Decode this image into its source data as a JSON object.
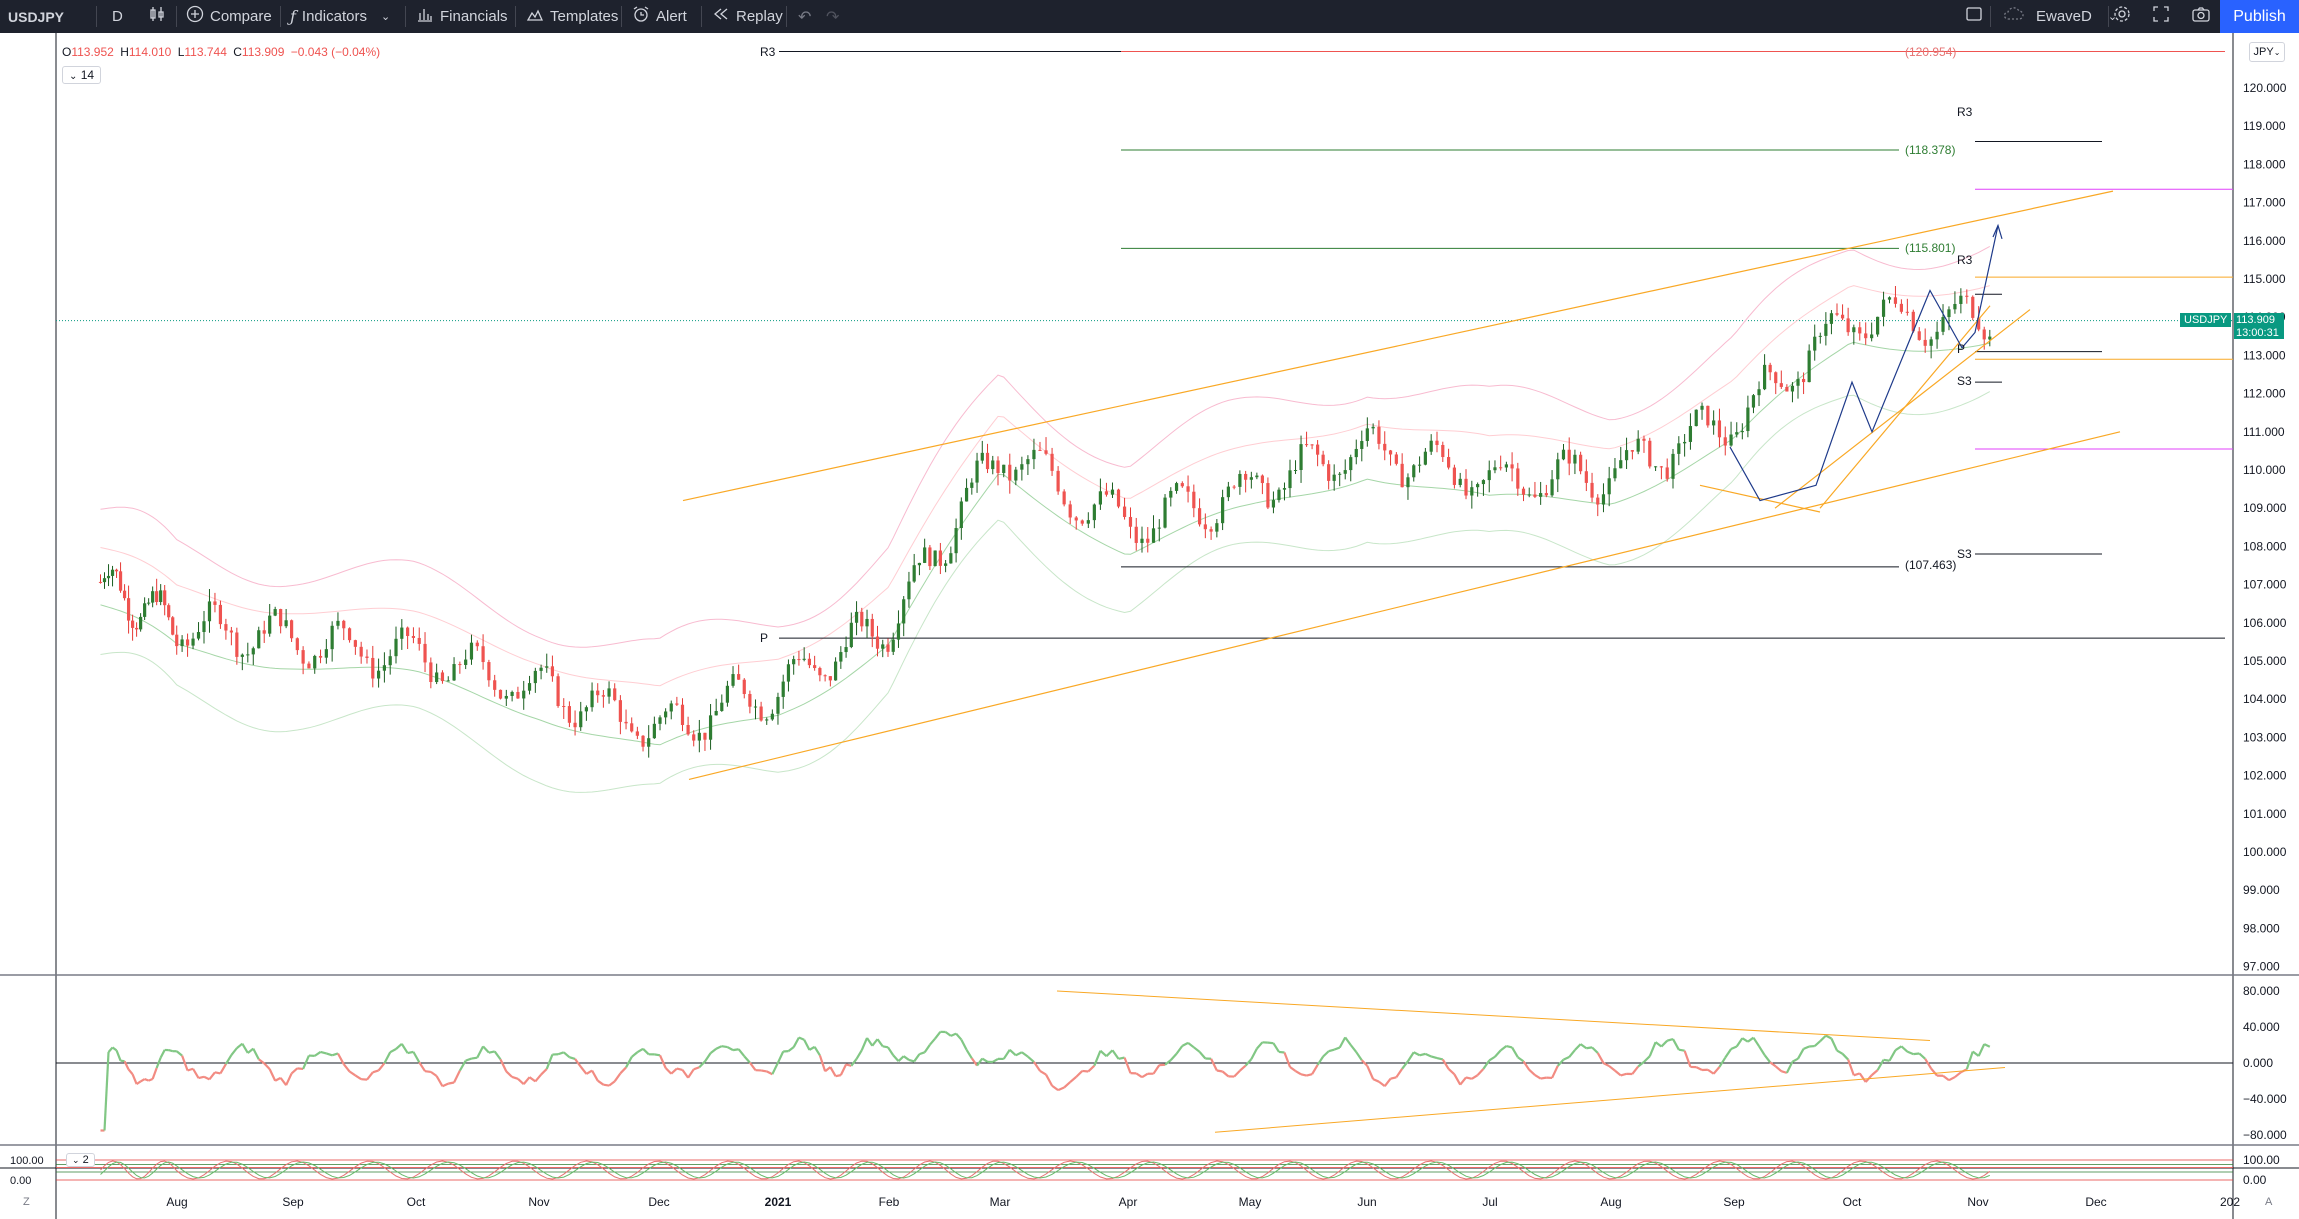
{
  "toolbar": {
    "symbol": "USDJPY",
    "interval": "D",
    "compare_label": "Compare",
    "indicators_label": "Indicators",
    "financials_label": "Financials",
    "templates_label": "Templates",
    "alert_label": "Alert",
    "replay_label": "Replay",
    "layout_name": "EwaveD",
    "publish_label": "Publish"
  },
  "legend": {
    "open_label": "O",
    "open": "113.952",
    "high_label": "H",
    "high": "114.010",
    "low_label": "L",
    "low": "113.744",
    "close_label": "C",
    "close": "113.909",
    "change": "−0.043 (−0.04%)",
    "indicator_param": "14",
    "lower_param": "2"
  },
  "currency": "JPY",
  "price_axis": [
    "120.000",
    "119.000",
    "118.000",
    "117.000",
    "116.000",
    "115.000",
    "114.000",
    "113.000",
    "112.000",
    "111.000",
    "110.000",
    "109.000",
    "108.000",
    "107.000",
    "106.000",
    "105.000",
    "104.000",
    "103.000",
    "102.000",
    "101.000",
    "100.000",
    "99.000",
    "98.000",
    "97.000"
  ],
  "rsi_axis": [
    "80.000",
    "40.000",
    "0.000",
    "−40.000",
    "−80.000"
  ],
  "stoch_axis": [
    "100.00",
    "0.00"
  ],
  "time_axis": [
    "Aug",
    "Sep",
    "Oct",
    "Nov",
    "Dec",
    "2021",
    "Feb",
    "Mar",
    "Apr",
    "May",
    "Jun",
    "Jul",
    "Aug",
    "Sep",
    "Oct",
    "Nov",
    "Dec",
    "202"
  ],
  "last_price": {
    "symbol": "USDJPY",
    "price": "113.909",
    "countdown": "13:00:31"
  },
  "annotations": {
    "r3_left": "R3",
    "p_left": "P",
    "r3_right": "R3",
    "r3_right2": "R3",
    "p_right": "P",
    "s3_right": "S3",
    "s3_right2": "S3",
    "fib_120": "(120.954)",
    "fib_118": "(118.378)",
    "fib_115": "(115.801)",
    "fib_107": "(107.463)"
  },
  "bottom": {
    "left_btn": "Z",
    "right_btn": "A"
  },
  "colors": {
    "up": "#089981",
    "up_candle": "#1b7d1b",
    "down": "#ef5350",
    "accent": "#2962ff",
    "channel": "#f9a825",
    "rsi_up": "#81c784",
    "rsi_down": "#f28b82",
    "magenta": "#e040fb"
  },
  "chart_data": {
    "type": "line",
    "symbol": "USDJPY",
    "interval": "D",
    "ylim": [
      97,
      120.9
    ],
    "x_range": [
      "Jul 2020",
      "Jan 2022"
    ],
    "close_path": [
      {
        "x": "2020-07",
        "y": 107.2
      },
      {
        "x": "2020-08",
        "y": 105.9
      },
      {
        "x": "2020-09",
        "y": 105.6
      },
      {
        "x": "2020-10",
        "y": 105.1
      },
      {
        "x": "2020-11",
        "y": 104.3
      },
      {
        "x": "2020-12",
        "y": 103.2
      },
      {
        "x": "2021-01",
        "y": 104.3
      },
      {
        "x": "2021-02",
        "y": 106.0
      },
      {
        "x": "2021-03",
        "y": 110.5
      },
      {
        "x": "2021-04",
        "y": 108.5
      },
      {
        "x": "2021-05",
        "y": 109.5
      },
      {
        "x": "2021-06",
        "y": 110.6
      },
      {
        "x": "2021-07",
        "y": 109.7
      },
      {
        "x": "2021-08",
        "y": 109.9
      },
      {
        "x": "2021-09",
        "y": 111.3
      },
      {
        "x": "2021-10",
        "y": 114.0
      },
      {
        "x": "2021-11",
        "y": 113.9
      }
    ],
    "horizontal_levels": [
      120.954,
      118.378,
      115.801,
      107.463,
      105.6
    ],
    "rsi_ylim": [
      -80,
      80
    ],
    "stoch_ylim": [
      0,
      100
    ]
  }
}
